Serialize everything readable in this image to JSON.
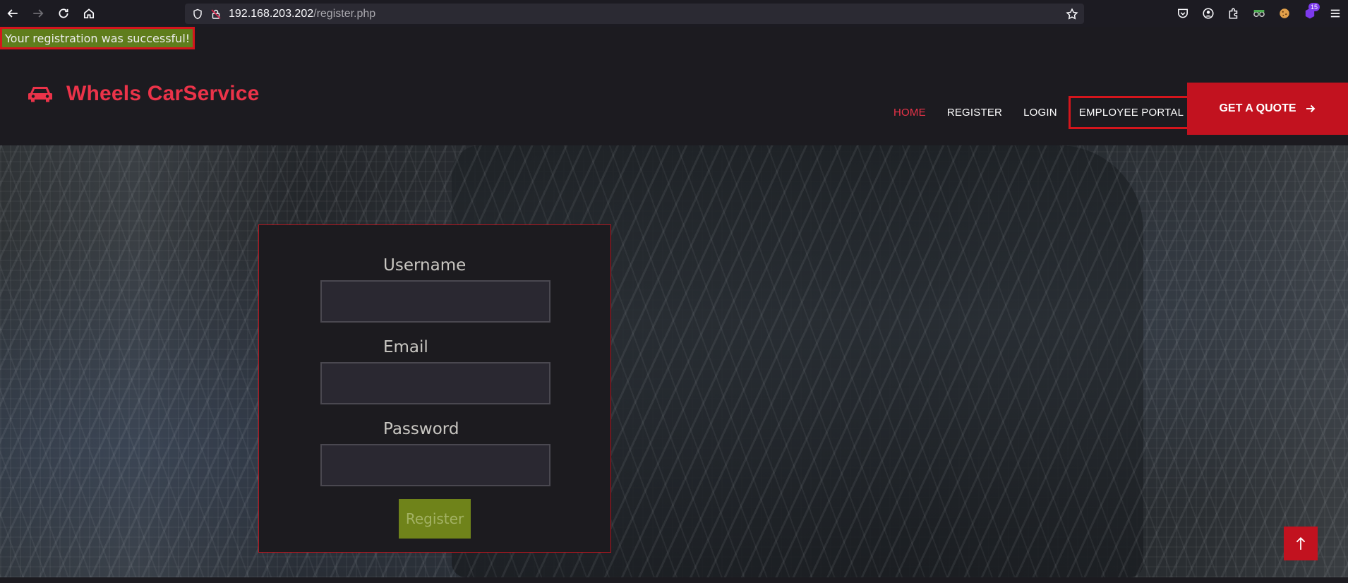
{
  "browser": {
    "url_host": "192.168.203.202",
    "url_path": "/register.php",
    "extensions_badge": "15"
  },
  "alert": {
    "text": "Your registration was successful!"
  },
  "header": {
    "brand": "Wheels CarService",
    "nav": [
      {
        "label": "HOME"
      },
      {
        "label": "REGISTER"
      },
      {
        "label": "LOGIN"
      },
      {
        "label": "EMPLOYEE PORTAL"
      }
    ],
    "cta": "GET A QUOTE"
  },
  "form": {
    "username_label": "Username",
    "email_label": "Email",
    "password_label": "Password",
    "username_value": "",
    "email_value": "",
    "password_value": "",
    "submit_label": "Register"
  },
  "colors": {
    "brand_red": "#eb3349",
    "button_red": "#c2121f",
    "success_green": "#5f7d1c",
    "register_green": "#6f831a"
  }
}
